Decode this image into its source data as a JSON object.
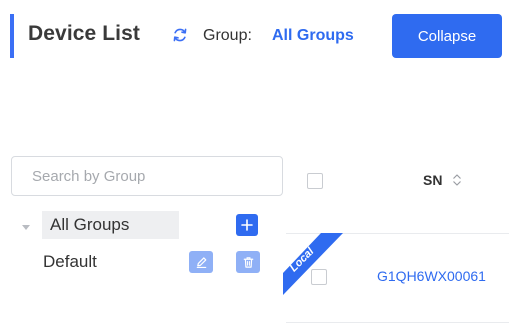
{
  "header": {
    "title": "Device List",
    "group_label": "Group:",
    "group_value": "All Groups",
    "collapse_label": "Collapse",
    "accent_color": "#3b6ff5",
    "primary_color": "#2f6bf0"
  },
  "sidebar": {
    "search_placeholder": "Search by Group",
    "tree": [
      {
        "label": "All Groups",
        "selected": true,
        "expanded": true
      },
      {
        "label": "Default",
        "selected": false
      }
    ]
  },
  "table": {
    "columns": [
      {
        "label": "SN",
        "sortable": true
      }
    ],
    "rows": [
      {
        "badge": "Local",
        "sn": "G1QH6WX00061"
      }
    ]
  }
}
